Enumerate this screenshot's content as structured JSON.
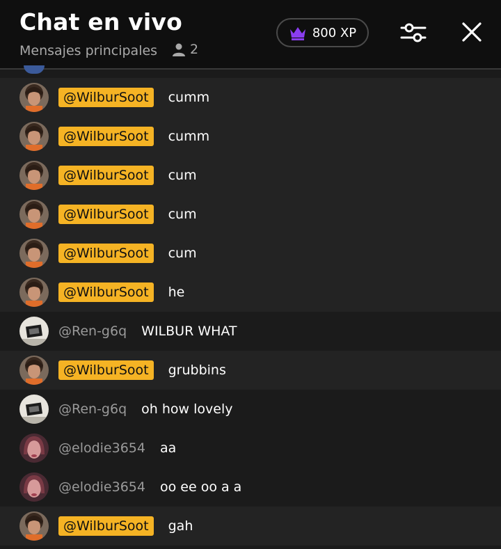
{
  "header": {
    "title": "Chat en vivo",
    "subtitle": "Mensajes principales",
    "viewer_count": "2",
    "xp_label": "800 XP",
    "colors": {
      "crown": "#8a3df0",
      "badge": "#f5b324"
    },
    "icons": [
      "person-icon",
      "crown-icon",
      "sliders-icon",
      "close-icon"
    ]
  },
  "messages": [
    {
      "user": "@WilburSoot",
      "text": "cumm",
      "owner": true,
      "avatar": "wilbur"
    },
    {
      "user": "@WilburSoot",
      "text": "cumm",
      "owner": true,
      "avatar": "wilbur"
    },
    {
      "user": "@WilburSoot",
      "text": "cum",
      "owner": true,
      "avatar": "wilbur"
    },
    {
      "user": "@WilburSoot",
      "text": "cum",
      "owner": true,
      "avatar": "wilbur"
    },
    {
      "user": "@WilburSoot",
      "text": "cum",
      "owner": true,
      "avatar": "wilbur"
    },
    {
      "user": "@WilburSoot",
      "text": "he",
      "owner": true,
      "avatar": "wilbur"
    },
    {
      "user": "@Ren-g6q",
      "text": "WILBUR WHAT",
      "owner": false,
      "avatar": "ren"
    },
    {
      "user": "@WilburSoot",
      "text": "grubbins",
      "owner": true,
      "avatar": "wilbur"
    },
    {
      "user": "@Ren-g6q",
      "text": "oh how lovely",
      "owner": false,
      "avatar": "ren"
    },
    {
      "user": "@elodie3654",
      "text": "aa",
      "owner": false,
      "avatar": "elodie"
    },
    {
      "user": "@elodie3654",
      "text": "oo ee oo a a",
      "owner": false,
      "avatar": "elodie"
    },
    {
      "user": "@WilburSoot",
      "text": "gah",
      "owner": true,
      "avatar": "wilbur"
    }
  ]
}
